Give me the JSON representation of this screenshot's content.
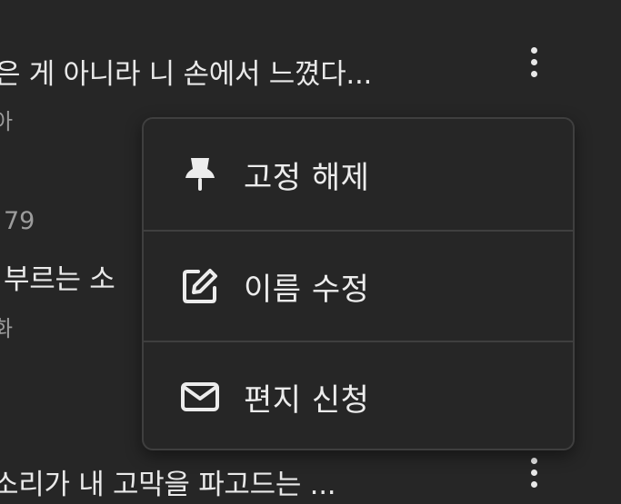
{
  "rows": [
    {
      "title": "은 게 아니라 니 손에서 느꼈다...",
      "subtitle": "아"
    },
    {
      "meta": "79",
      "title": "부르는 소",
      "subtitle": "화"
    },
    {
      "title": "소리가 내 고막을 파고드는 ..."
    }
  ],
  "context_menu": {
    "items": [
      {
        "label": "고정 해제",
        "icon": "pin-icon"
      },
      {
        "label": "이름 수정",
        "icon": "edit-icon"
      },
      {
        "label": "편지 신청",
        "icon": "mail-icon"
      }
    ]
  }
}
